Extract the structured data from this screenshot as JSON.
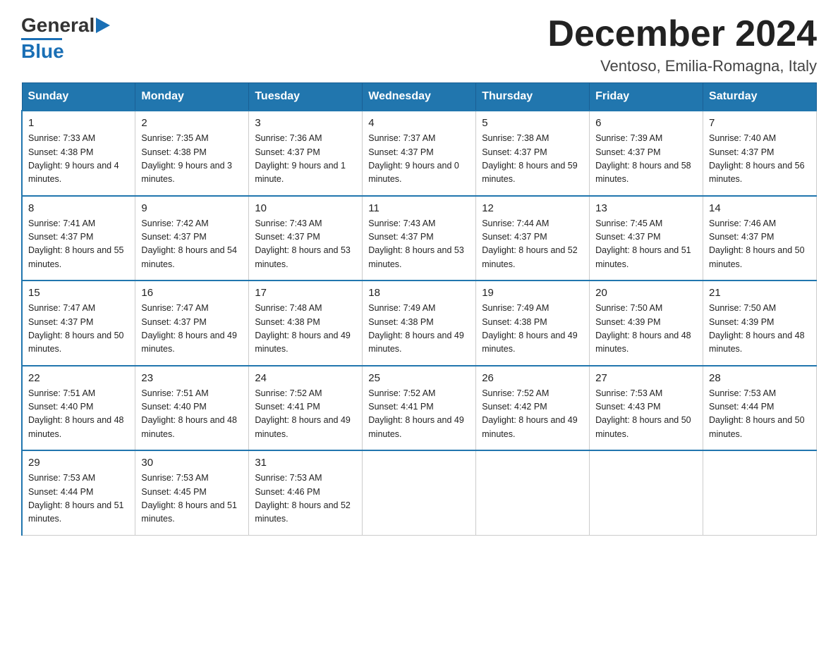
{
  "header": {
    "logo_general": "General",
    "logo_blue": "Blue",
    "month_title": "December 2024",
    "location": "Ventoso, Emilia-Romagna, Italy"
  },
  "days_of_week": [
    "Sunday",
    "Monday",
    "Tuesday",
    "Wednesday",
    "Thursday",
    "Friday",
    "Saturday"
  ],
  "weeks": [
    [
      {
        "day": "1",
        "sunrise": "7:33 AM",
        "sunset": "4:38 PM",
        "daylight": "9 hours and 4 minutes."
      },
      {
        "day": "2",
        "sunrise": "7:35 AM",
        "sunset": "4:38 PM",
        "daylight": "9 hours and 3 minutes."
      },
      {
        "day": "3",
        "sunrise": "7:36 AM",
        "sunset": "4:37 PM",
        "daylight": "9 hours and 1 minute."
      },
      {
        "day": "4",
        "sunrise": "7:37 AM",
        "sunset": "4:37 PM",
        "daylight": "9 hours and 0 minutes."
      },
      {
        "day": "5",
        "sunrise": "7:38 AM",
        "sunset": "4:37 PM",
        "daylight": "8 hours and 59 minutes."
      },
      {
        "day": "6",
        "sunrise": "7:39 AM",
        "sunset": "4:37 PM",
        "daylight": "8 hours and 58 minutes."
      },
      {
        "day": "7",
        "sunrise": "7:40 AM",
        "sunset": "4:37 PM",
        "daylight": "8 hours and 56 minutes."
      }
    ],
    [
      {
        "day": "8",
        "sunrise": "7:41 AM",
        "sunset": "4:37 PM",
        "daylight": "8 hours and 55 minutes."
      },
      {
        "day": "9",
        "sunrise": "7:42 AM",
        "sunset": "4:37 PM",
        "daylight": "8 hours and 54 minutes."
      },
      {
        "day": "10",
        "sunrise": "7:43 AM",
        "sunset": "4:37 PM",
        "daylight": "8 hours and 53 minutes."
      },
      {
        "day": "11",
        "sunrise": "7:43 AM",
        "sunset": "4:37 PM",
        "daylight": "8 hours and 53 minutes."
      },
      {
        "day": "12",
        "sunrise": "7:44 AM",
        "sunset": "4:37 PM",
        "daylight": "8 hours and 52 minutes."
      },
      {
        "day": "13",
        "sunrise": "7:45 AM",
        "sunset": "4:37 PM",
        "daylight": "8 hours and 51 minutes."
      },
      {
        "day": "14",
        "sunrise": "7:46 AM",
        "sunset": "4:37 PM",
        "daylight": "8 hours and 50 minutes."
      }
    ],
    [
      {
        "day": "15",
        "sunrise": "7:47 AM",
        "sunset": "4:37 PM",
        "daylight": "8 hours and 50 minutes."
      },
      {
        "day": "16",
        "sunrise": "7:47 AM",
        "sunset": "4:37 PM",
        "daylight": "8 hours and 49 minutes."
      },
      {
        "day": "17",
        "sunrise": "7:48 AM",
        "sunset": "4:38 PM",
        "daylight": "8 hours and 49 minutes."
      },
      {
        "day": "18",
        "sunrise": "7:49 AM",
        "sunset": "4:38 PM",
        "daylight": "8 hours and 49 minutes."
      },
      {
        "day": "19",
        "sunrise": "7:49 AM",
        "sunset": "4:38 PM",
        "daylight": "8 hours and 49 minutes."
      },
      {
        "day": "20",
        "sunrise": "7:50 AM",
        "sunset": "4:39 PM",
        "daylight": "8 hours and 48 minutes."
      },
      {
        "day": "21",
        "sunrise": "7:50 AM",
        "sunset": "4:39 PM",
        "daylight": "8 hours and 48 minutes."
      }
    ],
    [
      {
        "day": "22",
        "sunrise": "7:51 AM",
        "sunset": "4:40 PM",
        "daylight": "8 hours and 48 minutes."
      },
      {
        "day": "23",
        "sunrise": "7:51 AM",
        "sunset": "4:40 PM",
        "daylight": "8 hours and 48 minutes."
      },
      {
        "day": "24",
        "sunrise": "7:52 AM",
        "sunset": "4:41 PM",
        "daylight": "8 hours and 49 minutes."
      },
      {
        "day": "25",
        "sunrise": "7:52 AM",
        "sunset": "4:41 PM",
        "daylight": "8 hours and 49 minutes."
      },
      {
        "day": "26",
        "sunrise": "7:52 AM",
        "sunset": "4:42 PM",
        "daylight": "8 hours and 49 minutes."
      },
      {
        "day": "27",
        "sunrise": "7:53 AM",
        "sunset": "4:43 PM",
        "daylight": "8 hours and 50 minutes."
      },
      {
        "day": "28",
        "sunrise": "7:53 AM",
        "sunset": "4:44 PM",
        "daylight": "8 hours and 50 minutes."
      }
    ],
    [
      {
        "day": "29",
        "sunrise": "7:53 AM",
        "sunset": "4:44 PM",
        "daylight": "8 hours and 51 minutes."
      },
      {
        "day": "30",
        "sunrise": "7:53 AM",
        "sunset": "4:45 PM",
        "daylight": "8 hours and 51 minutes."
      },
      {
        "day": "31",
        "sunrise": "7:53 AM",
        "sunset": "4:46 PM",
        "daylight": "8 hours and 52 minutes."
      },
      null,
      null,
      null,
      null
    ]
  ]
}
